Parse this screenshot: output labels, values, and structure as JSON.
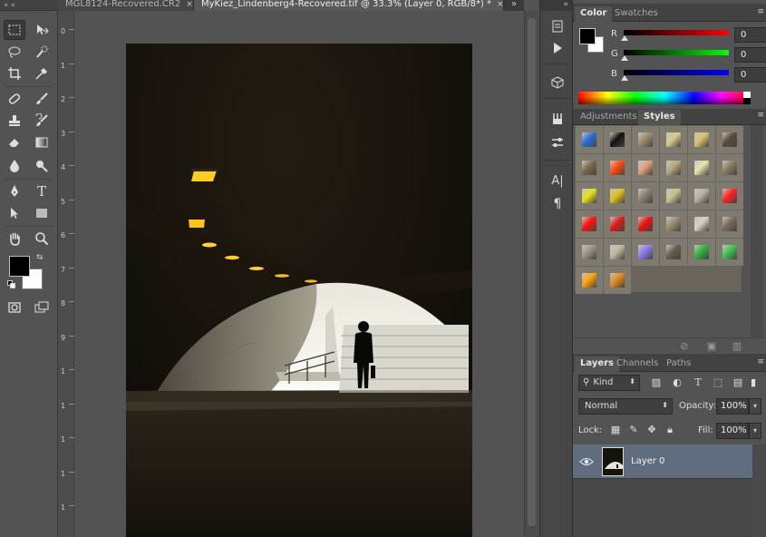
{
  "tabs": [
    {
      "label": "MGL8124-Recovered.CR2",
      "closable": true
    },
    {
      "label": "MyKiez_Lindenberg4-Recovered.tif @ 33.3% (Layer 0, RGB/8*) *",
      "closable": true
    }
  ],
  "tab_close_glyph": "×",
  "tab_overflow_glyph": "»",
  "ruler_vertical": [
    "0",
    "1",
    "2",
    "3",
    "4",
    "5",
    "6",
    "7",
    "8",
    "9",
    "1",
    "1",
    "1",
    "1",
    "1"
  ],
  "tools": [
    {
      "name": "rectangular-marquee-tool-icon",
      "active": true
    },
    {
      "name": "move-tool-icon"
    },
    {
      "name": "lasso-tool-icon"
    },
    {
      "name": "quick-selection-tool-icon"
    },
    {
      "name": "crop-tool-icon"
    },
    {
      "name": "eyedropper-tool-icon"
    },
    {
      "name": "spot-healing-brush-icon"
    },
    {
      "name": "brush-tool-icon"
    },
    {
      "name": "clone-stamp-tool-icon"
    },
    {
      "name": "history-brush-icon"
    },
    {
      "name": "eraser-tool-icon"
    },
    {
      "name": "gradient-tool-icon"
    },
    {
      "name": "blur-tool-icon"
    },
    {
      "name": "dodge-tool-icon"
    },
    {
      "name": "pen-tool-icon"
    },
    {
      "name": "type-tool-icon"
    },
    {
      "name": "path-selection-tool-icon"
    },
    {
      "name": "rectangle-shape-tool-icon"
    },
    {
      "name": "hand-tool-icon"
    },
    {
      "name": "zoom-tool-icon"
    }
  ],
  "type_tool_glyph": "T",
  "foreground_color": "#000000",
  "background_color": "#ffffff",
  "color_panel": {
    "tabs": [
      "Color",
      "Swatches"
    ],
    "active_tab": "Color",
    "channels": [
      {
        "label": "R",
        "value": "0",
        "gradient": "linear-gradient(to right, #000000, #ff0000)"
      },
      {
        "label": "G",
        "value": "0",
        "gradient": "linear-gradient(to right, #000000, #00ff00)"
      },
      {
        "label": "B",
        "value": "0",
        "gradient": "linear-gradient(to right, #000000, #0000ff)"
      }
    ]
  },
  "styles_panel": {
    "tabs": [
      "Adjustments",
      "Styles"
    ],
    "active_tab": "Styles",
    "swatches": [
      "#2c6cd9",
      "#111111",
      "#9c8c6e",
      "#d8c98a",
      "#d8c070",
      "#5a4a36",
      "#7a6a4e",
      "#ff4a10",
      "#e0a07a",
      "#b8a880",
      "#e8e0b0",
      "#8a7a60",
      "#e8e020",
      "#e0c020",
      "#8a8070",
      "#c8c090",
      "#b8b0a0",
      "#ff2020",
      "#ff1010",
      "#e01818",
      "#ee1010",
      "#9a8a70",
      "#d8d0c0",
      "#7a6a58",
      "#a09480",
      "#c0b8a0",
      "#8a7aee",
      "#6a5a48",
      "#30b040",
      "#40c050",
      "#ffa010",
      "#e08a20"
    ],
    "footer_icons": [
      "clear-style-icon",
      "new-style-icon",
      "delete-style-icon"
    ]
  },
  "layers_panel": {
    "tabs": [
      "Layers",
      "Channels",
      "Paths"
    ],
    "active_tab": "Layers",
    "filter_kind": "Kind",
    "filter_icons": [
      "pixel-filter-icon",
      "adjustment-filter-icon",
      "type-filter-icon",
      "shape-filter-icon",
      "smart-object-filter-icon"
    ],
    "type_filter_glyph": "T",
    "blend_mode": "Normal",
    "opacity_label": "Opacity:",
    "opacity_value": "100%",
    "lock_label": "Lock:",
    "fill_label": "Fill:",
    "fill_value": "100%",
    "layers": [
      {
        "name": "Layer 0",
        "visible": true,
        "selected": true
      }
    ]
  },
  "dock_buttons": [
    "history-icon",
    "play-actions-icon",
    "3d-icon",
    "brush-presets-icon",
    "tool-presets-icon",
    "character-icon",
    "paragraph-icon"
  ],
  "character_glyph": "A|",
  "paragraph_glyph": "¶"
}
